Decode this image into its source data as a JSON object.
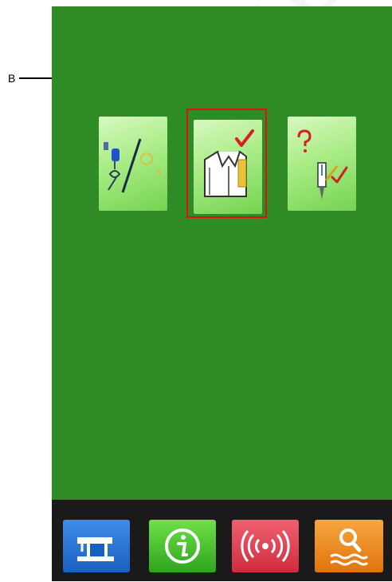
{
  "annotation": {
    "label": "B",
    "highlight_color": "#e21010"
  },
  "main_icons": [
    {
      "icon": "needle-thread-tension-icon"
    },
    {
      "icon": "sewing-pattern-confirm-icon"
    },
    {
      "icon": "needle-check-help-icon"
    }
  ],
  "bottom_bar": [
    {
      "icon": "sewing-machine-icon",
      "color": "#2b78d8"
    },
    {
      "icon": "info-icon",
      "color": "#3cbf26"
    },
    {
      "icon": "communication-icon",
      "color": "#e24050"
    },
    {
      "icon": "search-icon",
      "color": "#ee8a1e"
    }
  ],
  "colors": {
    "screen_background": "#2e8b25",
    "bottom_bar_background": "#1a1a1a"
  }
}
